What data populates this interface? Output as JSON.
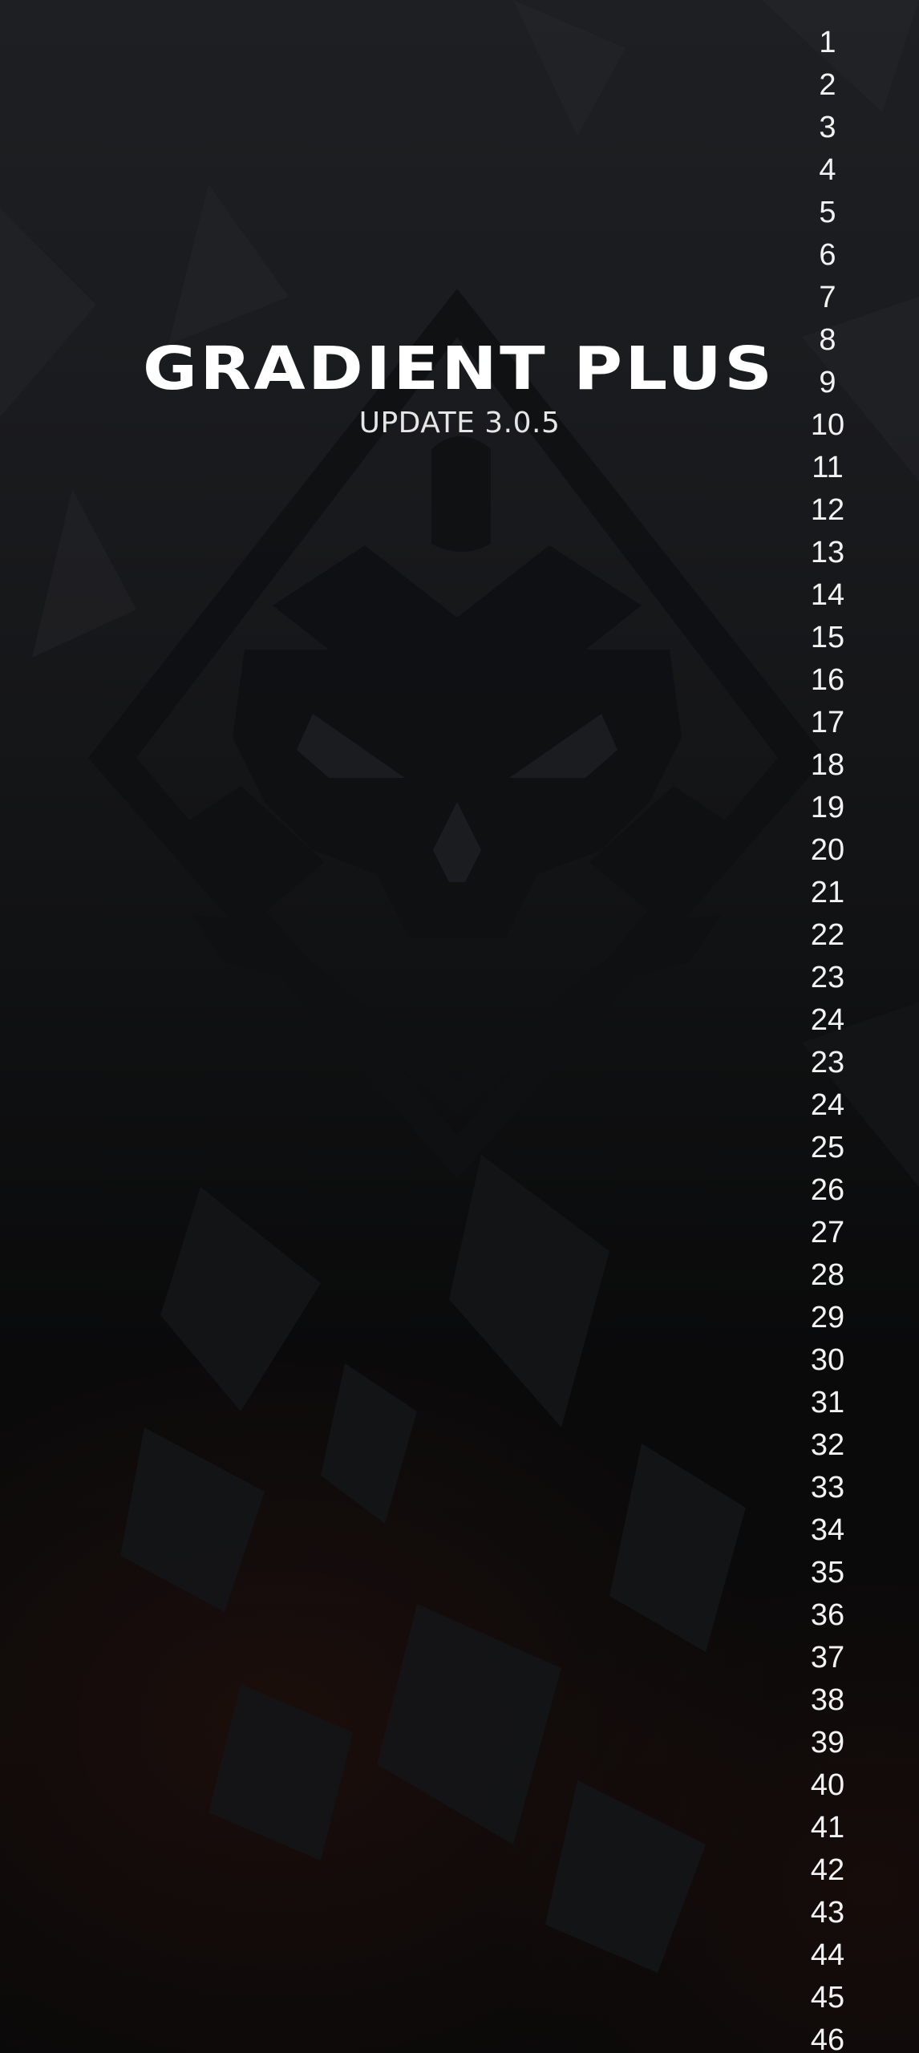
{
  "header": {
    "title": "GRADIENT PLUS",
    "subtitle": "UPDATE 3.0.5"
  },
  "background": {
    "emblem": "siege-skull-emblem-icon",
    "logo": "rainbow-six-siege-logo-icon"
  },
  "line_numbers": [
    "1",
    "2",
    "3",
    "4",
    "5",
    "6",
    "7",
    "8",
    "9",
    "10",
    "11",
    "12",
    "13",
    "14",
    "15",
    "16",
    "17",
    "18",
    "19",
    "20",
    "21",
    "22",
    "23",
    "24",
    "23",
    "24",
    "25",
    "26",
    "27",
    "28",
    "29",
    "30",
    "31",
    "32",
    "33",
    "34",
    "35",
    "36",
    "37",
    "38",
    "39",
    "40",
    "41",
    "42",
    "43",
    "44",
    "45",
    "46"
  ],
  "colors": {
    "background_top": "#1d1f22",
    "background_bottom": "#0a0909",
    "text": "#ffffff",
    "emblem": "#0e0f10"
  }
}
